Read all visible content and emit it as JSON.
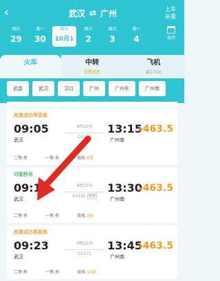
{
  "header": {
    "back_icon": "chevron-left-icon",
    "from": "武汉",
    "swap_icon": "swap-icon",
    "to": "广州",
    "period_line1": "上车",
    "period_line2": "补票",
    "calendar_label": "日历"
  },
  "dates": [
    {
      "weekday": "周日",
      "day": "29",
      "selected": false
    },
    {
      "weekday": "周一",
      "day": "30",
      "selected": false
    },
    {
      "weekday": "周五",
      "day": "10月1日",
      "selected": true
    },
    {
      "weekday": "周六",
      "day": "2",
      "selected": false
    },
    {
      "weekday": "周日",
      "day": "3",
      "selected": false
    },
    {
      "weekday": "周一",
      "day": "4",
      "selected": false
    }
  ],
  "tabs": [
    {
      "title": "火车",
      "sub": "",
      "selected": true
    },
    {
      "title": "中转",
      "sub": "余票充足",
      "selected": false
    },
    {
      "title": "飞机",
      "sub": "省172元",
      "selected": false
    }
  ],
  "stations": [
    "武昌",
    "武汉",
    "汉口",
    "广州",
    "广州东",
    "广州南"
  ],
  "trains": [
    {
      "header": "抢票成功率高者",
      "depart": "09:05",
      "from": "武汉",
      "duration": "4时10分",
      "train_no": "G1109",
      "stop_tag": "",
      "arrive": "13:15",
      "to": "广州南",
      "price_currency": "¥",
      "price_value": "463.5",
      "seat_1": "二等:",
      "seat_1_count": "有",
      "seat_2": "一等:",
      "seat_2_count": "有",
      "seat_3": "商务:",
      "seat_3_count": "6张"
    },
    {
      "header": "可能秒杀",
      "depart": "09:10",
      "from": "武汉",
      "duration": "4时20分",
      "train_no": "G1155",
      "stop_tag": "经停",
      "arrive": "13:30",
      "to": "广州南",
      "price_currency": "¥",
      "price_value": "463.5",
      "seat_1": "二等:",
      "seat_1_count": "有",
      "seat_2": "一等:",
      "seat_2_count": "有",
      "seat_3": "商务:",
      "seat_3_count": "3张"
    },
    {
      "header": "抢票成功率极高",
      "depart": "09:23",
      "from": "武汉",
      "duration": "4时22分",
      "train_no": "G1171",
      "stop_tag": "",
      "arrive": "13:45",
      "to": "广州南",
      "price_currency": "¥",
      "price_value": "463.5",
      "seat_1": "二等:",
      "seat_1_count": "有",
      "seat_2": "一等:",
      "seat_2_count": "有",
      "seat_3": "商务:",
      "seat_3_count": "10张"
    }
  ],
  "annotation": {
    "arrow_color": "#e02b20"
  }
}
